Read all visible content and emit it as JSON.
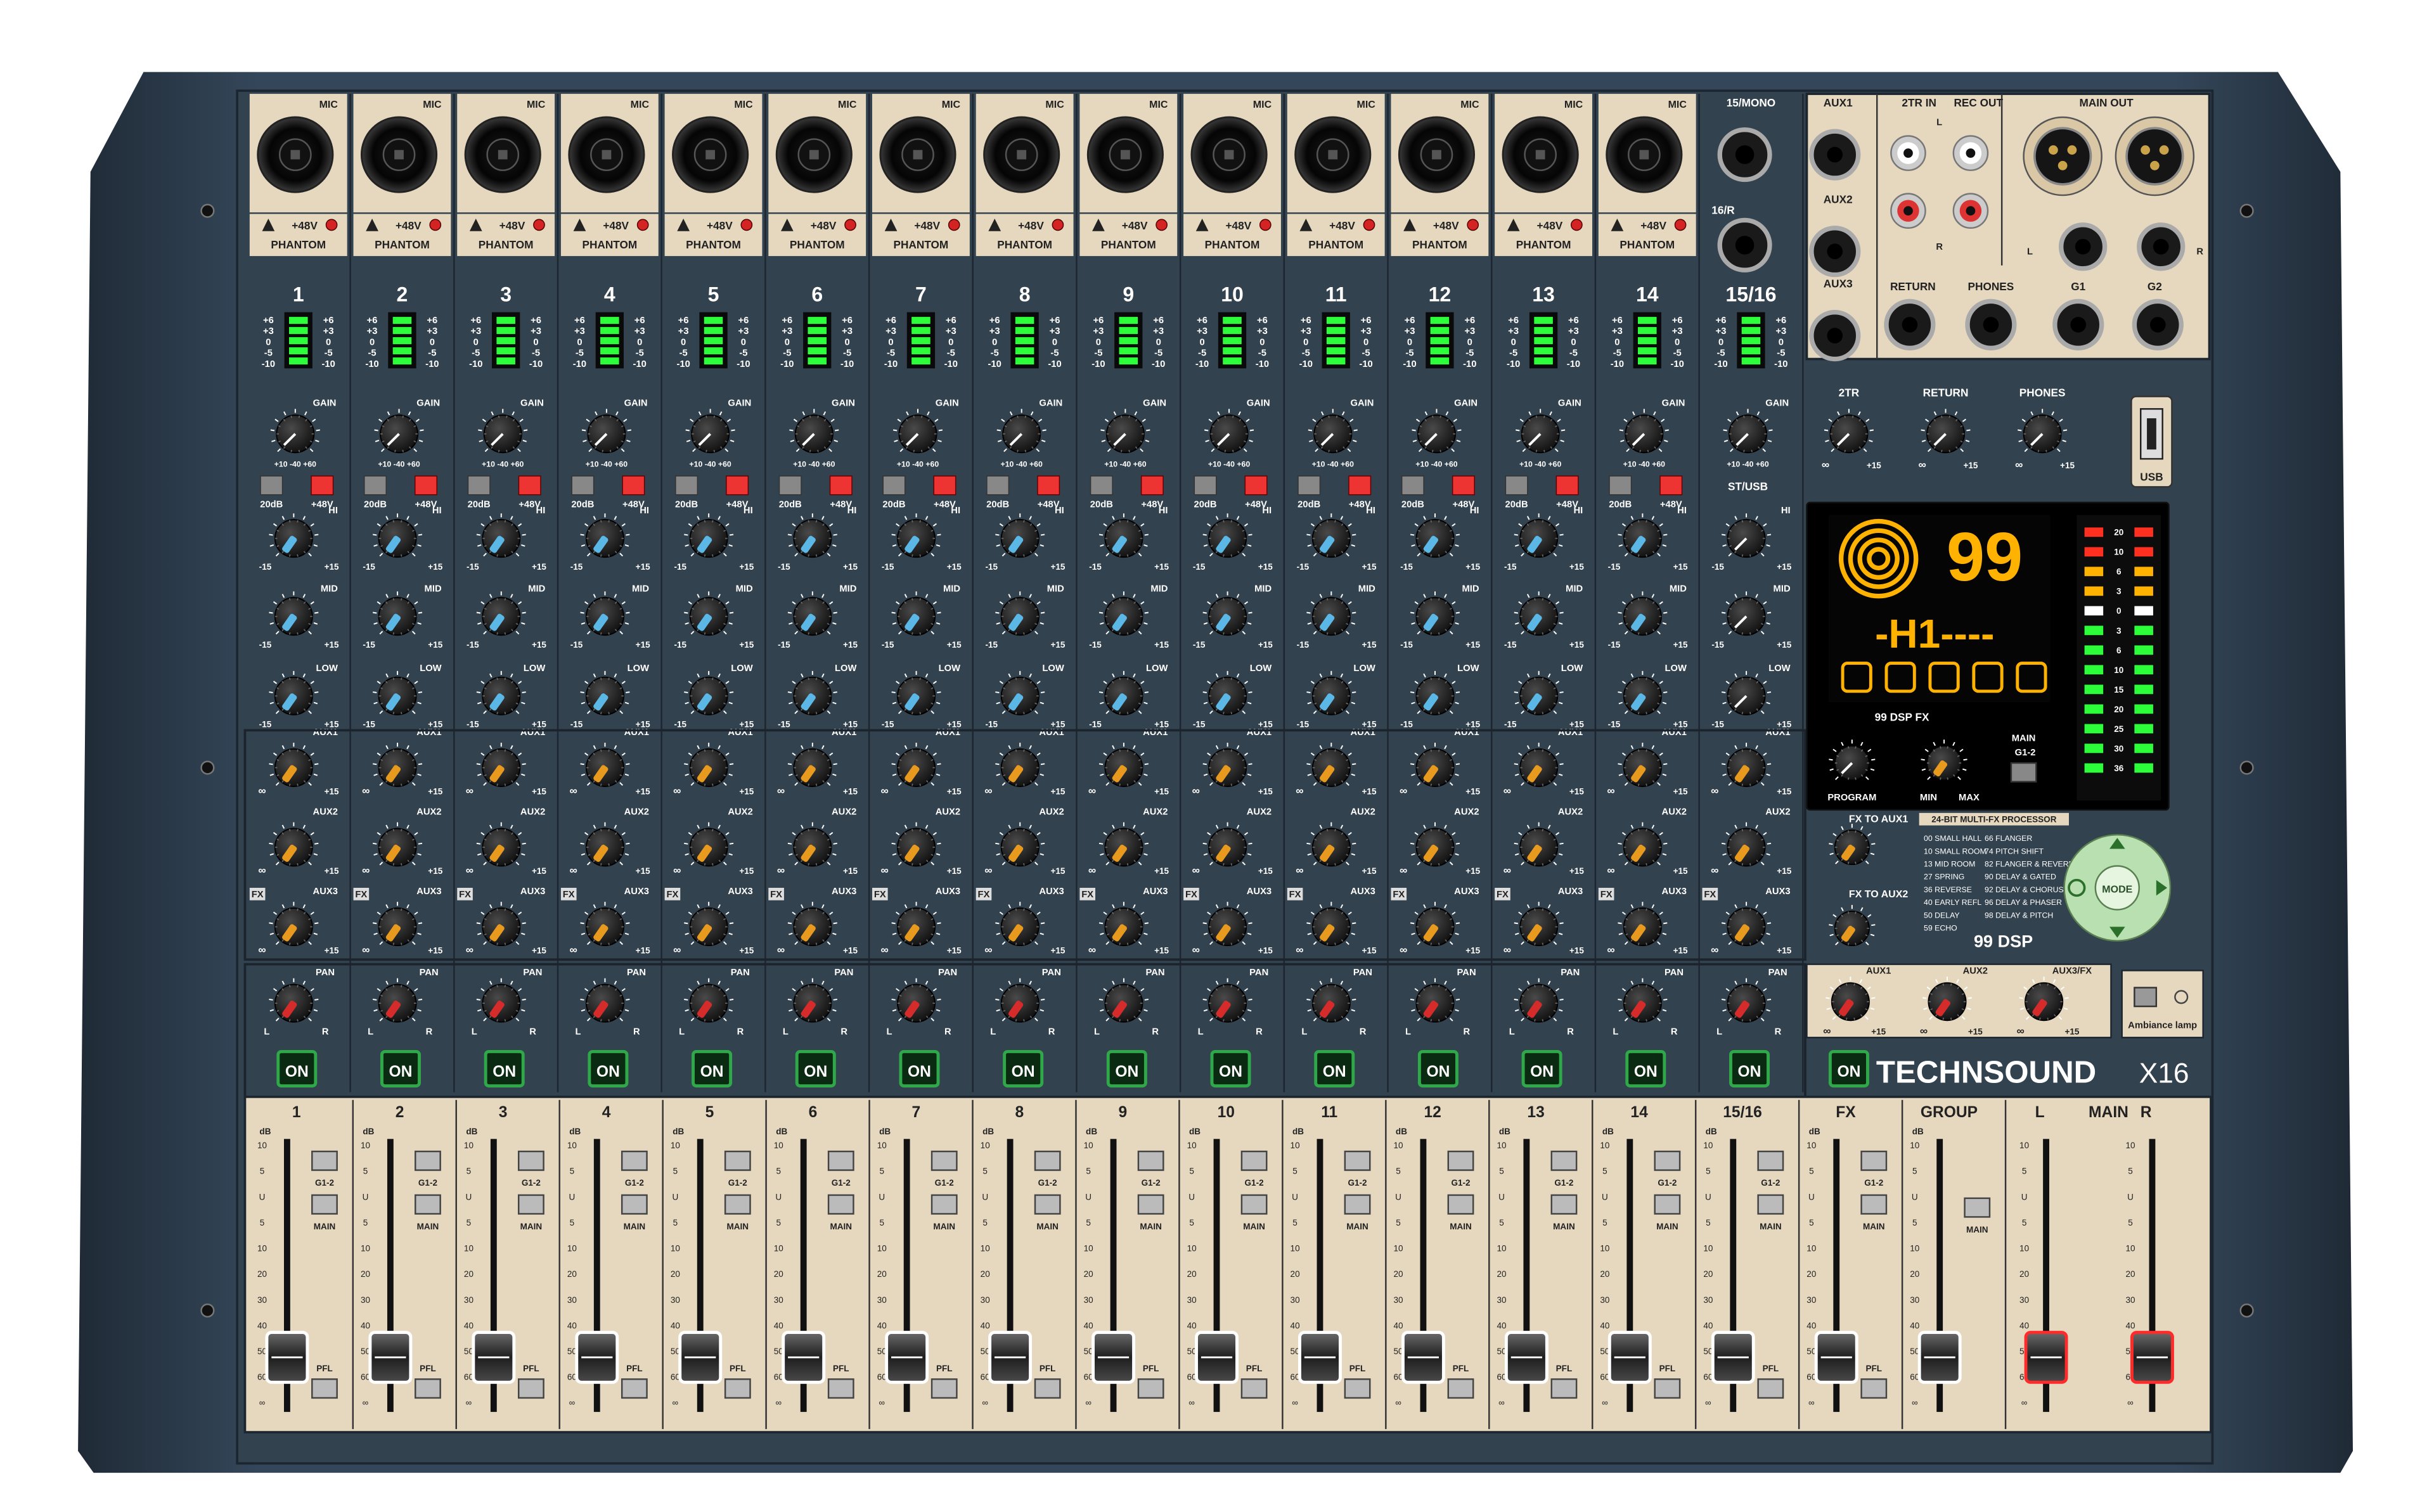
{
  "brand": {
    "name": "TECHNSOUND",
    "model": "X16"
  },
  "channels": [
    "1",
    "2",
    "3",
    "4",
    "5",
    "6",
    "7",
    "8",
    "9",
    "10",
    "11",
    "12",
    "13",
    "14"
  ],
  "stereo_channel": "15/16",
  "labels": {
    "mic": "MIC",
    "phantom_warn": "+48V",
    "phantom": "PHANTOM",
    "gain": "GAIN",
    "pad": "20dB",
    "phantom_sw": "+48V",
    "hi": "HI",
    "mid": "MID",
    "low": "LOW",
    "aux1": "AUX1",
    "aux2": "AUX2",
    "aux3": "AUX3",
    "fx": "FX",
    "pan": "PAN",
    "on": "ON",
    "eq_min": "-15",
    "eq_max": "+15",
    "inf": "∞",
    "l": "L",
    "r": "R",
    "st_usb": "ST/USB",
    "mono": "15/MONO",
    "stereo_r": "16/R",
    "g12": "G1-2",
    "main_btn": "MAIN",
    "pfl": "PFL",
    "db": "dB"
  },
  "meter_scale": [
    "+6",
    "+3",
    "0",
    "-5",
    "-10"
  ],
  "fader_scale": [
    "10",
    "5",
    "U",
    "5",
    "10",
    "20",
    "30",
    "40",
    "50",
    "60",
    "∞"
  ],
  "io_panel": {
    "aux1": "AUX1",
    "aux2": "AUX2",
    "aux3": "AUX3",
    "tr_in": "2TR IN",
    "rec_out": "REC OUT",
    "main_out": "MAIN OUT",
    "return": "RETURN",
    "phones": "PHONES",
    "g1": "G1",
    "g2": "G2",
    "l": "L",
    "r": "R"
  },
  "master_knobs": [
    "2TR",
    "RETURN",
    "PHONES"
  ],
  "usb": "USB",
  "dsp": {
    "display_number": "99",
    "display_text": "-H1----",
    "fx_label": "99 DSP FX",
    "program": "PROGRAM",
    "min": "MIN",
    "max": "MAX",
    "main": "MAIN",
    "g12": "G1-2",
    "processor_title": "24-BIT MULTI-FX PROCESSOR",
    "presets_left": [
      "00 SMALL HALL",
      "10 SMALL ROOM",
      "13 MID ROOM",
      "27 SPRING",
      "36 REVERSE",
      "40 EARLY REFL",
      "50 DELAY",
      "59 ECHO"
    ],
    "presets_right": [
      "66 FLANGER",
      "74 PITCH SHIFT",
      "82 FLANGER & REVERB",
      "90 DELAY & GATED",
      "92 DELAY & CHORUS",
      "96 DELAY & PHASER",
      "98 DELAY & PITCH"
    ],
    "logo": "99 DSP",
    "mode": "MODE",
    "fx_to_aux1": "FX TO AUX1",
    "fx_to_aux2": "FX TO AUX2"
  },
  "led_meter": [
    "20",
    "10",
    "6",
    "3",
    "0",
    "3",
    "6",
    "10",
    "15",
    "20",
    "25",
    "30",
    "36"
  ],
  "fx_return_knobs": [
    "AUX1",
    "AUX2",
    "AUX3/FX"
  ],
  "ambiance": "Ambiance lamp",
  "fader_section": {
    "channels": [
      "1",
      "2",
      "3",
      "4",
      "5",
      "6",
      "7",
      "8",
      "9",
      "10",
      "11",
      "12",
      "13",
      "14",
      "15/16",
      "FX"
    ],
    "group": "GROUP",
    "main": "MAIN",
    "l": "L",
    "r": "R"
  },
  "colors": {
    "chassis": "#2f3f4f",
    "panel": "#32414f",
    "beige": "#e5d6bc",
    "eq_knob": "#5bb8e6",
    "aux_knob": "#e89a1e",
    "pan_knob": "#d62b2b",
    "led_green": "#2cff3a",
    "display_orange": "#ffb300"
  }
}
